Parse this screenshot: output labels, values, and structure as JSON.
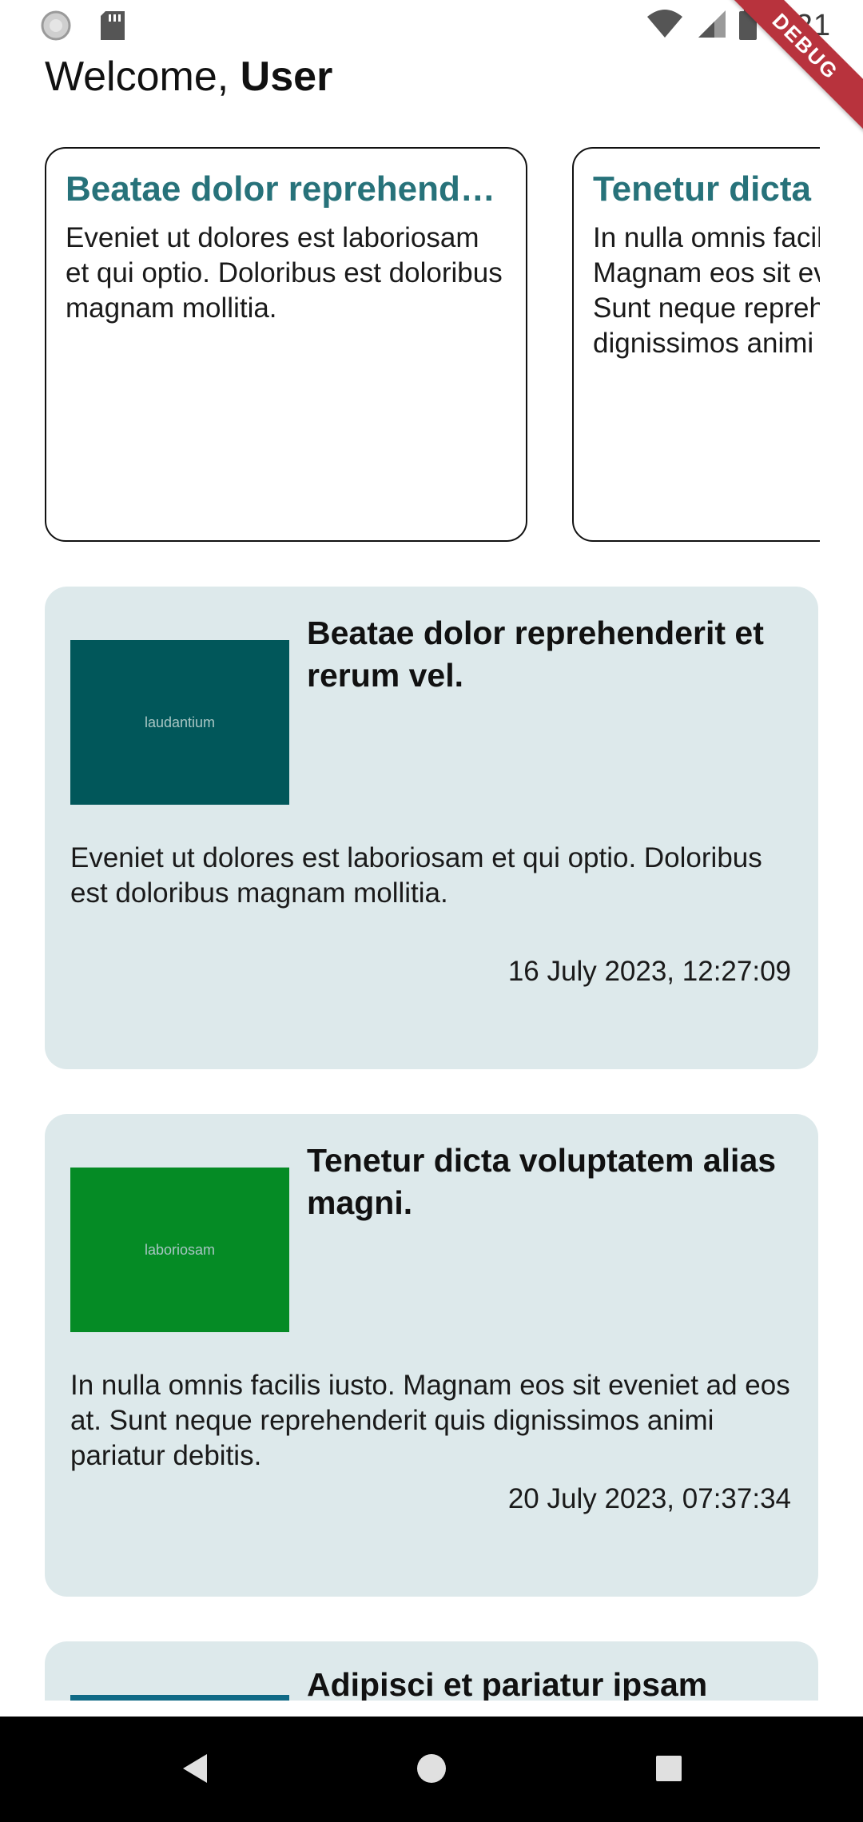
{
  "status_bar": {
    "time": "2:21",
    "icons": [
      "sync-icon",
      "sd-card-icon",
      "wifi-icon",
      "signal-icon",
      "battery-icon"
    ]
  },
  "debug_banner": "DEBUG",
  "header": {
    "greeting": "Welcome,",
    "user_name": "User"
  },
  "featured": [
    {
      "title": "Beatae dolor reprehenderit et rerum vel.",
      "body": "Eveniet ut dolores est laboriosam et qui optio. Doloribus est doloribus magnam mollitia."
    },
    {
      "title": "Tenetur dicta voluptatem alias magni.",
      "body": "In nulla omnis facilis iusto. Magnam eos sit eveniet ad eos at. Sunt neque reprehenderit quis dignissimos animi pariatur debitis."
    }
  ],
  "posts": [
    {
      "image_label": "laudantium",
      "image_color": "#01575a",
      "title": "Beatae dolor reprehenderit et rerum vel.",
      "body": "Eveniet ut dolores est laboriosam et qui optio. Doloribus est doloribus magnam mollitia.",
      "date": "16 July 2023, 12:27:09"
    },
    {
      "image_label": "laboriosam",
      "image_color": "#058b25",
      "title": "Tenetur dicta voluptatem alias magni.",
      "body": "In nulla omnis facilis iusto. Magnam eos sit eveniet ad eos at. Sunt neque reprehenderit quis dignissimos animi pariatur debitis.",
      "date": "20 July 2023, 07:37:34"
    },
    {
      "image_color": "#0f6a86",
      "title": "Adipisci et pariatur ipsam"
    }
  ],
  "colors": {
    "card_bg": "#dde9eb",
    "accent_title": "#27727a",
    "debug": "#b8333d"
  },
  "nav": {
    "icons": [
      "back-icon",
      "home-icon",
      "recents-icon"
    ]
  }
}
